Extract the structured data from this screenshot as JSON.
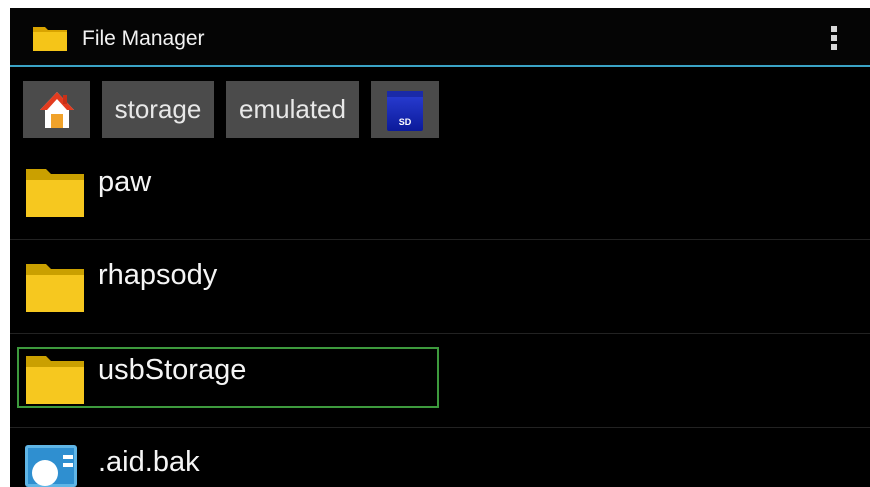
{
  "app": {
    "title": "File Manager",
    "app_icon": "folder-icon",
    "menu_icon": "overflow-menu-icon"
  },
  "breadcrumb": {
    "home_icon": "home-icon",
    "segments": [
      "storage",
      "emulated"
    ],
    "sd_icon": "sd-card-icon",
    "sd_label": "SD"
  },
  "files": [
    {
      "name": "paw",
      "type": "folder"
    },
    {
      "name": "rhapsody",
      "type": "folder"
    },
    {
      "name": "usbStorage",
      "type": "folder",
      "selected": true
    },
    {
      "name": ".aid.bak",
      "type": "file"
    }
  ],
  "colors": {
    "background": "#000000",
    "accent": "#3aa3c6",
    "breadcrumb_bg": "#4b4b4b",
    "selection": "#3d9a3d",
    "folder": "#f3c21a"
  }
}
